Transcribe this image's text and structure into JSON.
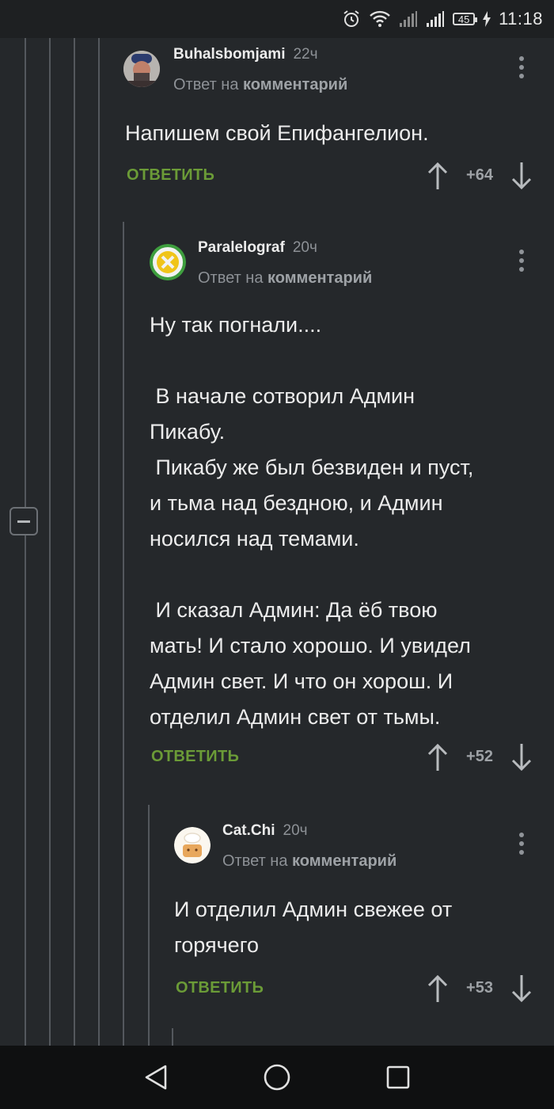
{
  "status_bar": {
    "battery": "45",
    "time": "11:18"
  },
  "comments": [
    {
      "author": "Buhalsbomjami",
      "time": "22ч",
      "reply_prefix": "Ответ на",
      "reply_target": "комментарий",
      "text": "Напишем свой Епифангелион.",
      "reply_label": "ОТВЕТИТЬ",
      "score": "+64"
    },
    {
      "author": "Paralelograf",
      "time": "20ч",
      "reply_prefix": "Ответ на",
      "reply_target": "комментарий",
      "text": "Ну так погнали....\n\n В начале сотворил Админ\nПикабу.\n Пикабу же был безвиден и пуст,\nи тьма над бездною, и Админ\nносился над темами.\n\n И сказал Админ: Да ёб твою\nмать! И стало хорошо. И увидел\nАдмин свет. И что он хорош. И\nотделил Админ свет от тьмы.",
      "reply_label": "ОТВЕТИТЬ",
      "score": "+52"
    },
    {
      "author": "Cat.Chi",
      "time": "20ч",
      "reply_prefix": "Ответ на",
      "reply_target": "комментарий",
      "text": "И отделил Админ свежее от\nгорячего",
      "reply_label": "ОТВЕТИТЬ",
      "score": "+53"
    }
  ],
  "icons": {
    "status": [
      "alarm-icon",
      "wifi-icon",
      "signal-icon",
      "signal-icon",
      "battery-icon",
      "charging-icon"
    ],
    "vote": [
      "arrow-up-icon",
      "arrow-down-icon"
    ],
    "navigation": [
      "back-icon",
      "home-icon",
      "recents-icon"
    ]
  },
  "colors": {
    "reply_accent": "#6b9b37",
    "background": "#25282b"
  }
}
